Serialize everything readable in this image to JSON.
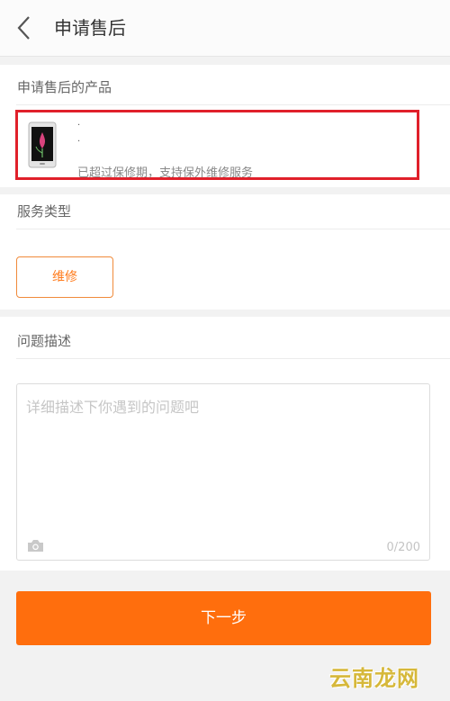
{
  "header": {
    "title": "申请售后"
  },
  "product_section": {
    "title": "申请售后的产品",
    "product": {
      "name_line": "·",
      "spec_line": "·",
      "warranty_status": "已超过保修期，支持保外维修服务"
    }
  },
  "service_section": {
    "title": "服务类型",
    "selected_type": "维修"
  },
  "problem_section": {
    "title": "问题描述",
    "placeholder": "详细描述下你遇到的问题吧",
    "counter": "0/200"
  },
  "footer": {
    "next_label": "下一步"
  },
  "watermark": "云南龙网",
  "colors": {
    "accent": "#ff6e0d",
    "highlight_border": "#e0202a"
  }
}
